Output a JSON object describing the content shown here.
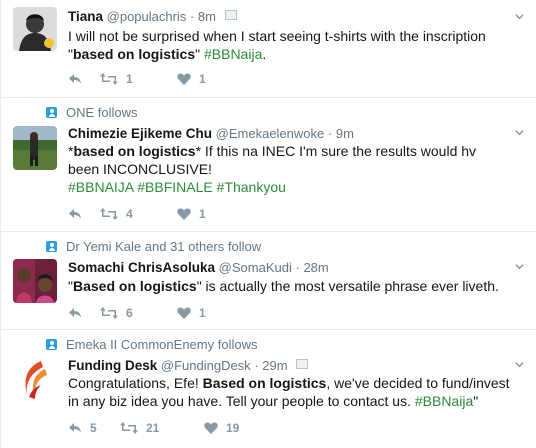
{
  "tweets": [
    {
      "context": "",
      "name": "Tiana",
      "handle": "@populachris",
      "time": "8m",
      "text_parts": [
        {
          "t": "I will not be surprised when I start seeing t-shirts with the inscription \"",
          "s": "n"
        },
        {
          "t": "based on logistics",
          "s": "b"
        },
        {
          "t": "\" ",
          "s": "n"
        },
        {
          "t": "#BBNaija",
          "s": "h"
        },
        {
          "t": ".",
          "s": "n"
        }
      ],
      "retweets": "1",
      "likes": "1"
    },
    {
      "context": "ONE follows",
      "name": "Chimezie Ejikeme Chu",
      "handle": "@Emekaelenwoke",
      "time": "9m",
      "text_parts": [
        {
          "t": "*",
          "s": "n"
        },
        {
          "t": "based on logistics",
          "s": "b"
        },
        {
          "t": "* If this na INEC I'm  sure the results would hv been INCONCLUSIVE!",
          "s": "n"
        },
        {
          "t": "\n",
          "s": "br"
        },
        {
          "t": "#BBNAIJA #BBFINALE #Thankyou",
          "s": "h"
        }
      ],
      "retweets": "4",
      "likes": "1"
    },
    {
      "context": "Dr Yemi Kale and 31 others follow",
      "name": "Somachi ChrisAsoluka",
      "handle": "@SomaKudi",
      "time": "28m",
      "text_parts": [
        {
          "t": "\"",
          "s": "n"
        },
        {
          "t": "Based on logistics",
          "s": "b"
        },
        {
          "t": "\" is actually the most versatile phrase ever liveth.",
          "s": "n"
        }
      ],
      "retweets": "6",
      "likes": "1"
    },
    {
      "context": "Emeka II CommonEnemy follows",
      "name": "Funding Desk",
      "handle": "@FundingDesk",
      "time": "29m",
      "text_parts": [
        {
          "t": "Congratulations, Efe! ",
          "s": "n"
        },
        {
          "t": "Based on logistics",
          "s": "b"
        },
        {
          "t": ", we've decided to fund/invest in any biz idea you have. Tell your people to contact us. ",
          "s": "n"
        },
        {
          "t": "#BBNaija",
          "s": "h"
        },
        {
          "t": "\"",
          "s": "n"
        }
      ],
      "replies": "5",
      "retweets": "21",
      "likes": "19"
    }
  ],
  "colors": {
    "hashtag": "#2e8b37",
    "muted": "#657786",
    "icon": "#8899a6",
    "context_icon": "#2b9ee6"
  },
  "icons": [
    "reply-icon",
    "retweet-icon",
    "like-icon",
    "chevron-down-icon",
    "follow-context-icon",
    "photo-icon"
  ]
}
